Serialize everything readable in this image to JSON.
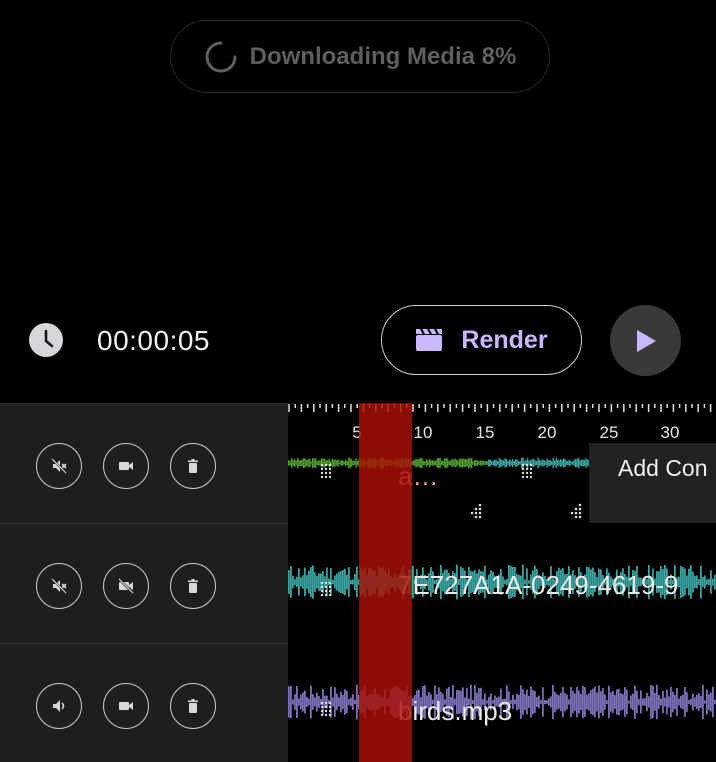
{
  "download": {
    "label": "Downloading Media 8%",
    "progress_percent": 8
  },
  "controls": {
    "time": "00:00:05",
    "render_label": "Render"
  },
  "ruler": {
    "labels": [
      "5",
      "10",
      "15",
      "20",
      "25",
      "30"
    ]
  },
  "tracks": [
    {
      "clips": [
        {
          "label": "a…"
        }
      ],
      "add_content_label": "Add Con"
    },
    {
      "clips": [
        {
          "label": "7E727A1A-0249-4619-9"
        }
      ]
    },
    {
      "clips": [
        {
          "label": "birds.mp3"
        }
      ]
    }
  ],
  "colors": {
    "background": "#000000",
    "panel": "#1e1e20",
    "accent": "#c9b8ff",
    "playhead": "#aa1004",
    "wave_green": "#4f9a2e",
    "wave_teal": "#3aa39f",
    "wave_purple": "#7d6fb8"
  },
  "icons": [
    "spinner-icon",
    "clock-icon",
    "clapperboard-icon",
    "play-icon",
    "mute-icon",
    "camera-icon",
    "camera-off-icon",
    "trash-icon",
    "volume-icon",
    "drag-handle-icon"
  ]
}
